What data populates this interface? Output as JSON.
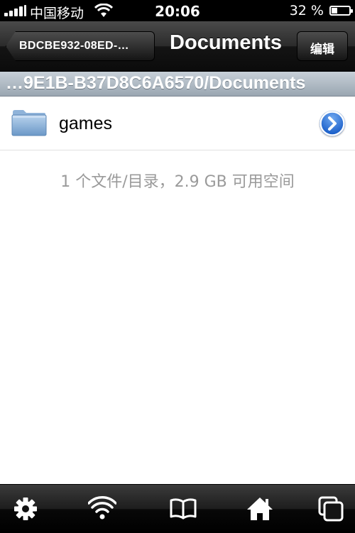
{
  "status_bar": {
    "carrier": "中国移动",
    "time": "20:06",
    "battery_percent_text": "32 %",
    "battery_level": 0.32
  },
  "nav": {
    "back_label": "BDCBE932-08ED-…",
    "title": "Documents",
    "edit_label": "编辑"
  },
  "path_bar": {
    "text": "…9E1B-B37D8C6A6570/Documents"
  },
  "list": {
    "items": [
      {
        "name": "games",
        "icon": "folder-icon",
        "accessory": "disclosure-button"
      }
    ],
    "summary": "1 个文件/目录，2.9 GB 可用空间"
  },
  "toolbar": {
    "items": [
      "gear-icon",
      "wifi-icon",
      "book-icon",
      "home-icon",
      "windows-icon"
    ]
  },
  "colors": {
    "nav_bar": "#1e1e1e",
    "path_bar": "#aab4be",
    "disclosure_blue": "#1b5fc9",
    "summary_text": "#9a9a9a"
  }
}
